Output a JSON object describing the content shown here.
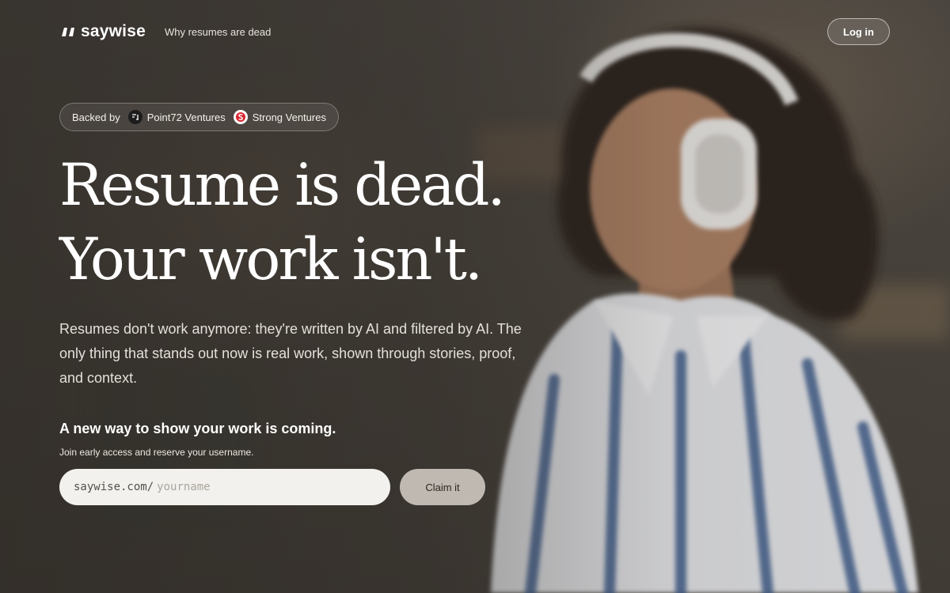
{
  "brand": {
    "name": "saywise",
    "logo_icon": "quote-mark-icon"
  },
  "header": {
    "nav_link": "Why resumes are dead",
    "login_label": "Log in"
  },
  "backed": {
    "prefix": "Backed by",
    "investors": [
      {
        "name": "Point72 Ventures",
        "icon": "point72-logo-icon"
      },
      {
        "name": "Strong Ventures",
        "icon": "strong-ventures-logo-icon"
      }
    ]
  },
  "hero": {
    "headline_line1": "Resume is dead.",
    "headline_line2": "Your work isn't.",
    "subtext": "Resumes don't work anymore: they're written by AI and filtered by AI. The only thing that stands out now is real work, shown through stories, proof, and context."
  },
  "waitlist": {
    "title": "A new way to show your work is coming.",
    "subtitle": "Join early access and reserve your username.",
    "url_prefix": "saywise.com/",
    "placeholder": "yourname",
    "value": "",
    "button_label": "Claim it"
  },
  "colors": {
    "background": "#4a4540",
    "text": "#ffffff",
    "input_bg": "#f3f1ed",
    "button_bg": "#bfb9b2"
  }
}
